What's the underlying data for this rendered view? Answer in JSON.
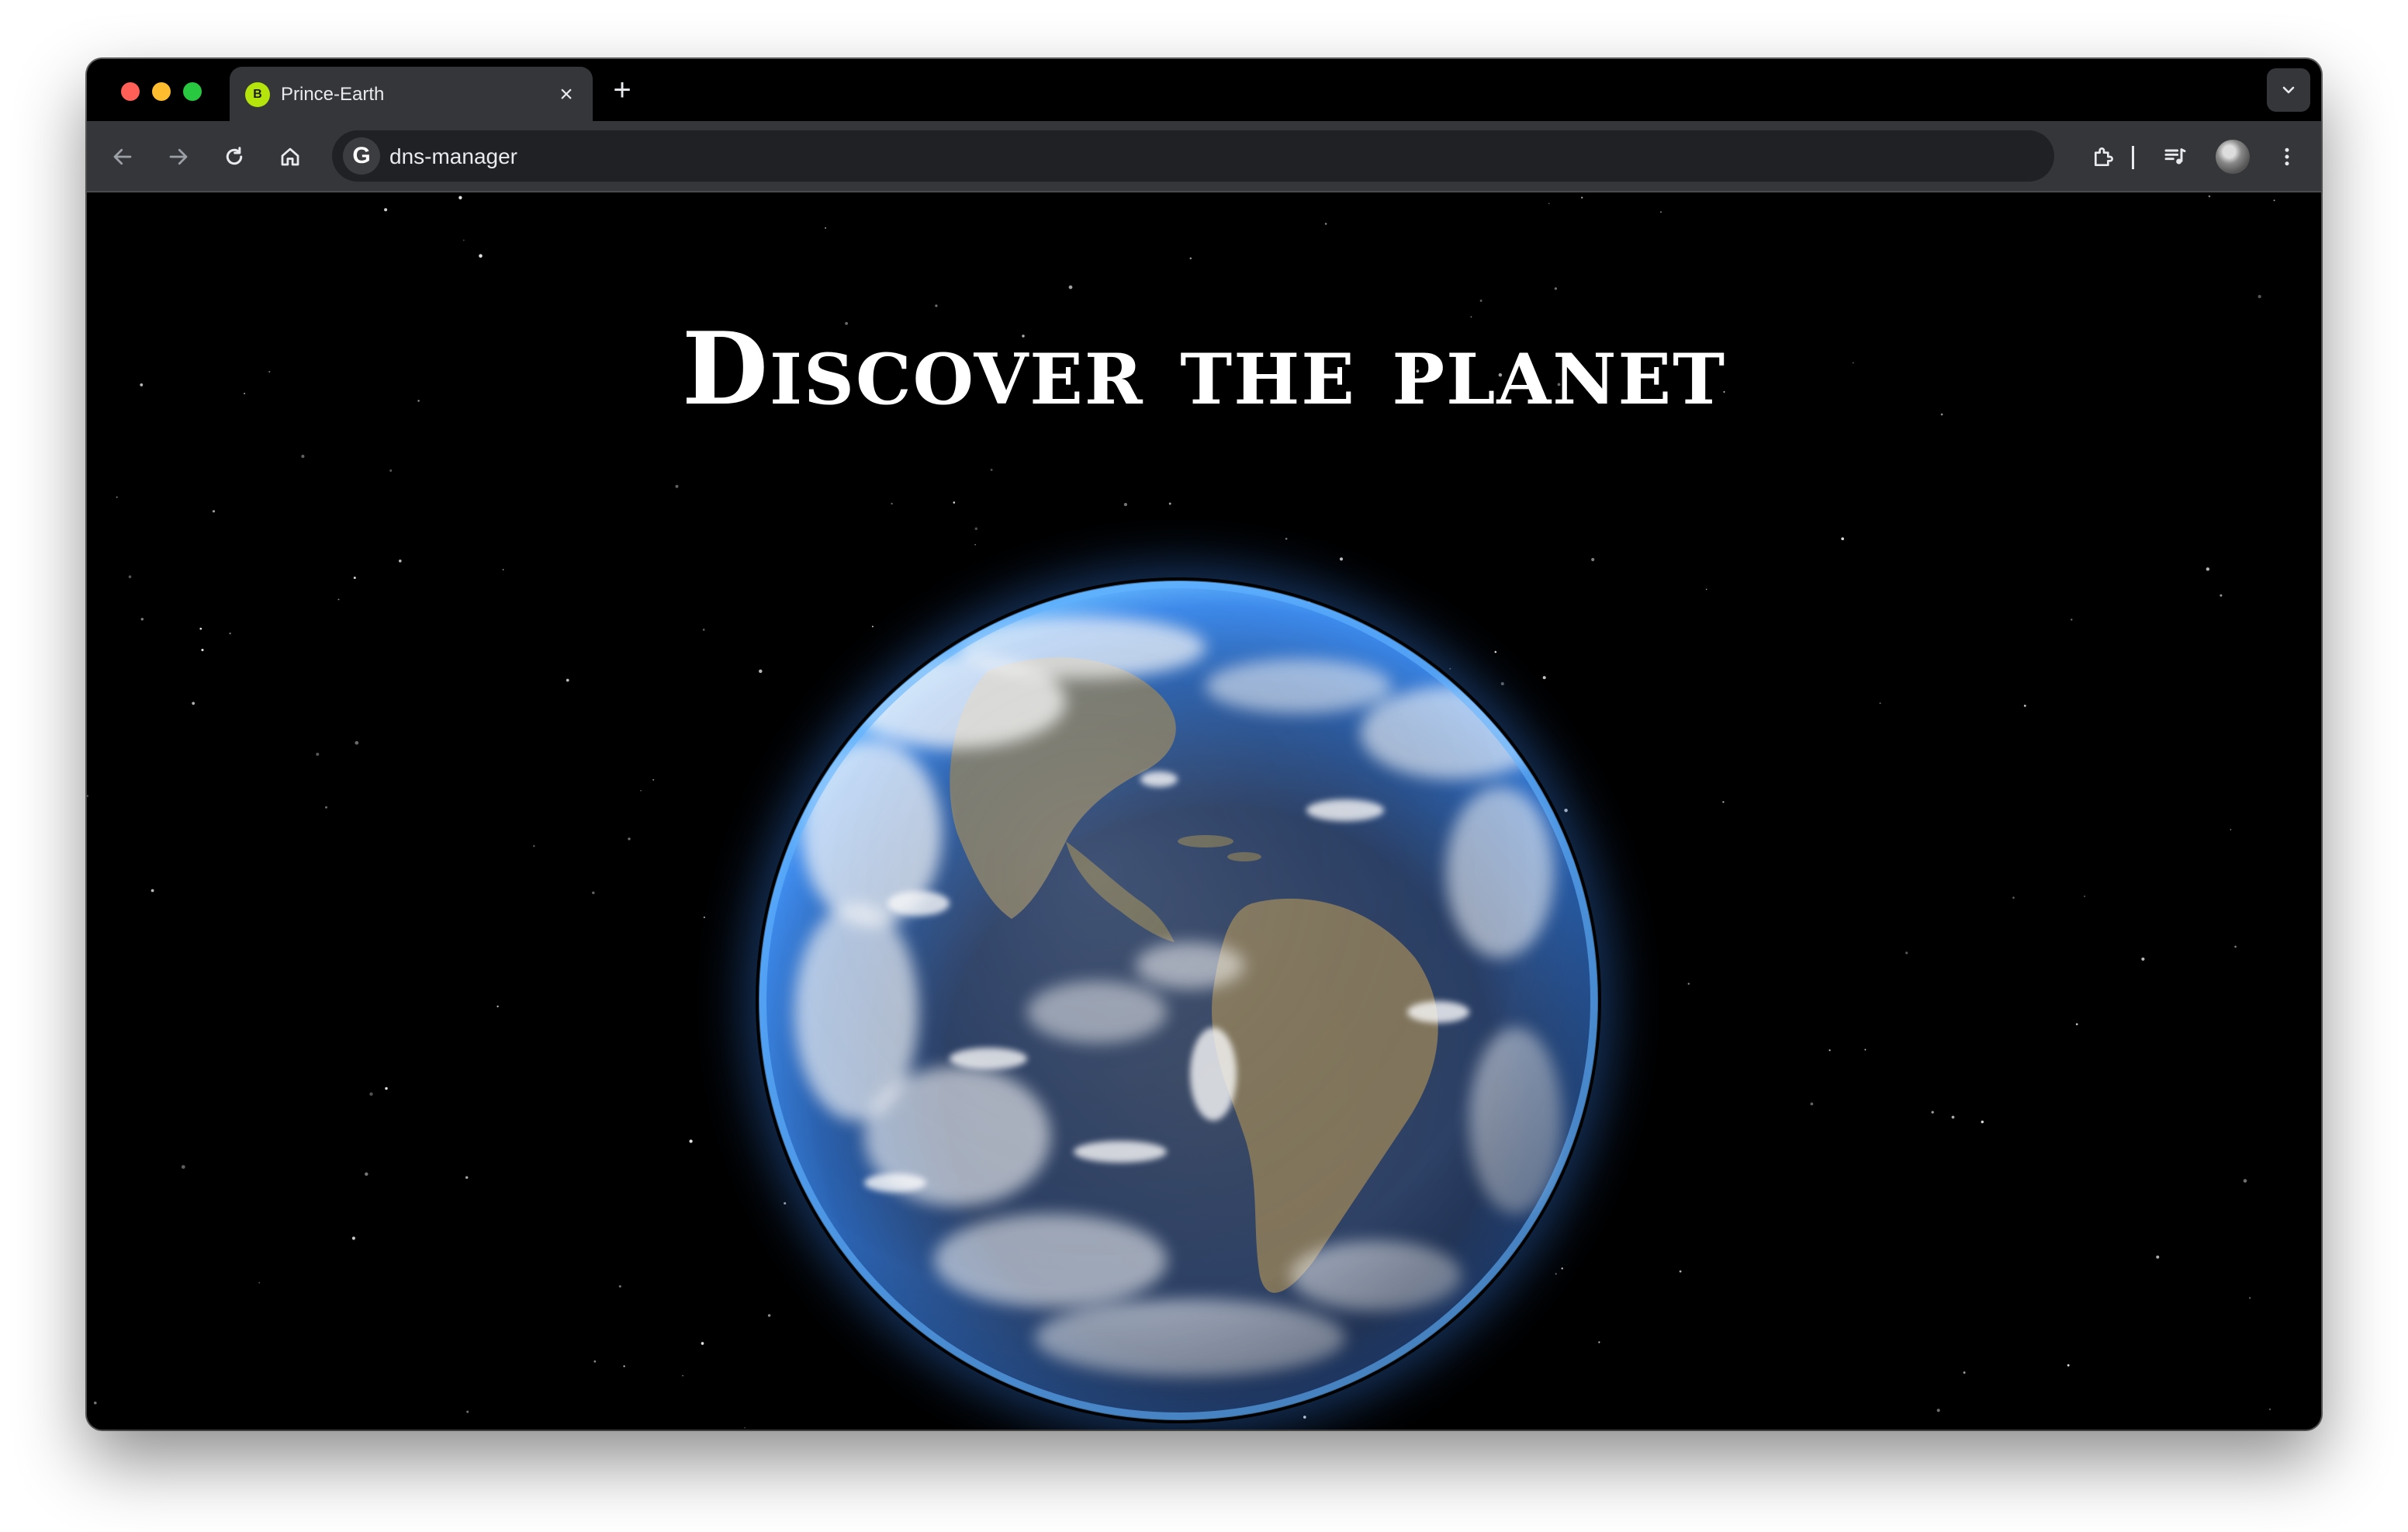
{
  "browser": {
    "tab": {
      "title": "Prince-Earth",
      "favicon_letter": "B",
      "favicon_color": "#b4e40c"
    },
    "new_tab_label": "+",
    "close_label": "×",
    "address": "dns-manager",
    "search_engine_letter": "G"
  },
  "page": {
    "hero_title": "Discover the planet"
  },
  "colors": {
    "window_bg": "#000000",
    "toolbar_bg": "#35363a",
    "omnibox_bg": "#202124",
    "text": "#e8eaed",
    "ocean": "#2e6fc4",
    "atmosphere": "#4a9dff"
  },
  "icons": [
    "back-icon",
    "forward-icon",
    "reload-icon",
    "home-icon",
    "extensions-icon",
    "media-icon",
    "avatar",
    "more-icon",
    "tab-search-icon"
  ]
}
